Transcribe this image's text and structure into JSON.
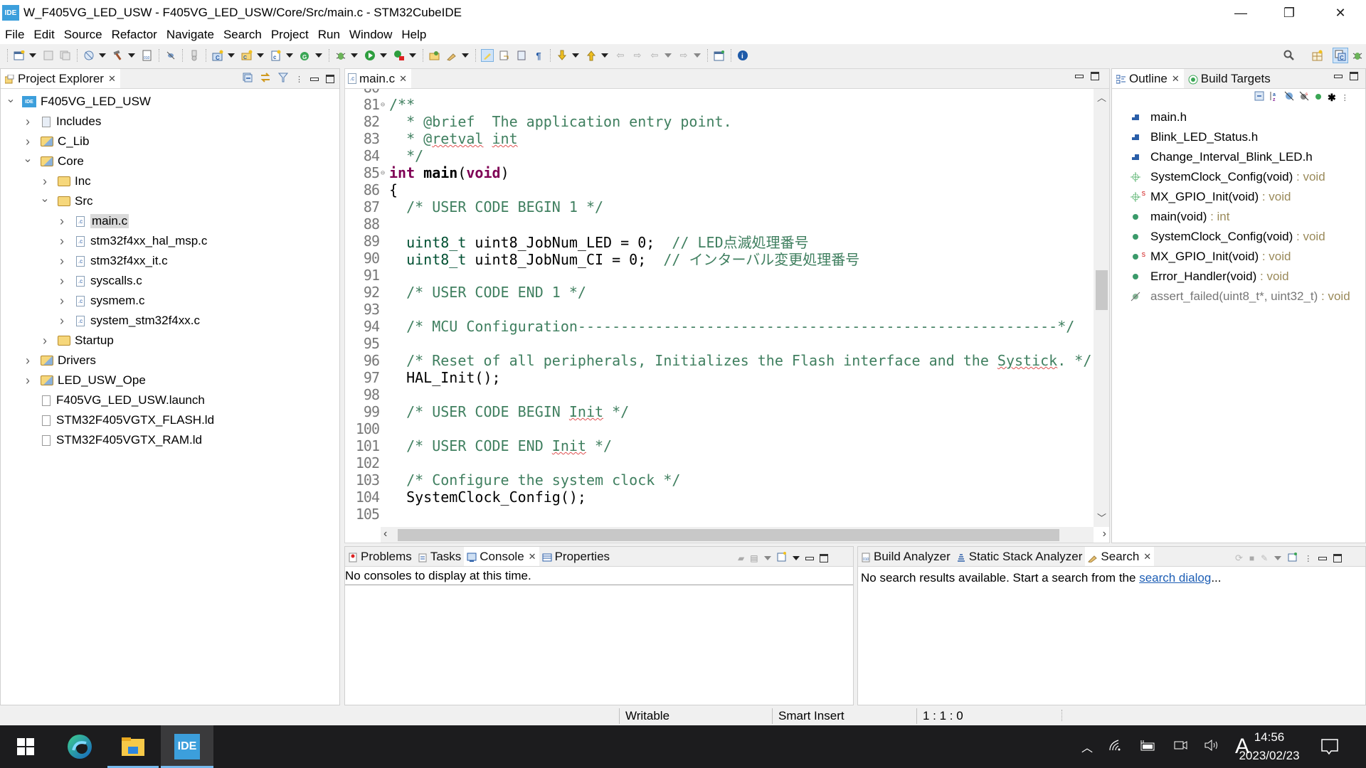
{
  "window": {
    "app_icon_label": "IDE",
    "title": "W_F405VG_LED_USW - F405VG_LED_USW/Core/Src/main.c - STM32CubeIDE",
    "minimize_glyph": "—",
    "restore_glyph": "❐",
    "close_glyph": "✕"
  },
  "menu": [
    "File",
    "Edit",
    "Source",
    "Refactor",
    "Navigate",
    "Search",
    "Project",
    "Run",
    "Window",
    "Help"
  ],
  "toolbar": {
    "icons": [
      "new-icon",
      "save-icon",
      "save-all-icon",
      "build-config-icon",
      "build-hammer-icon",
      "binary-icon",
      "debug-disconnect-icon",
      "device-config-icon",
      "new-c-project-icon",
      "new-source-folder-icon",
      "new-c-file-icon",
      "new-class-icon",
      "debug-icon",
      "run-icon",
      "run-external-icon",
      "open-perspective-icon",
      "mark-occurrences-icon",
      "toggle-highlight-icon",
      "show-whitespace-icon",
      "next-annotation-icon",
      "prev-annotation-icon",
      "back-icon",
      "forward-icon",
      "pin-editor-icon",
      "info-icon"
    ],
    "right_icons": [
      "search-icon",
      "open-perspective-icon",
      "c-perspective-icon",
      "debug-perspective-icon"
    ]
  },
  "project_explorer": {
    "tab_label": "Project Explorer",
    "items": [
      {
        "label": "F405VG_LED_USW",
        "depth": 0,
        "expanded": true,
        "icon": "project-icon"
      },
      {
        "label": "Includes",
        "depth": 1,
        "expanded": false,
        "icon": "includes-icon"
      },
      {
        "label": "C_Lib",
        "depth": 1,
        "expanded": false,
        "icon": "source-folder-icon"
      },
      {
        "label": "Core",
        "depth": 1,
        "expanded": true,
        "icon": "source-folder-icon"
      },
      {
        "label": "Inc",
        "depth": 2,
        "expanded": false,
        "icon": "folder-icon"
      },
      {
        "label": "Src",
        "depth": 2,
        "expanded": true,
        "icon": "folder-icon"
      },
      {
        "label": "main.c",
        "depth": 3,
        "expanded": false,
        "icon": "c-file-icon",
        "selected": true
      },
      {
        "label": "stm32f4xx_hal_msp.c",
        "depth": 3,
        "expanded": false,
        "icon": "c-file-icon"
      },
      {
        "label": "stm32f4xx_it.c",
        "depth": 3,
        "expanded": false,
        "icon": "c-file-icon"
      },
      {
        "label": "syscalls.c",
        "depth": 3,
        "expanded": false,
        "icon": "c-file-icon"
      },
      {
        "label": "sysmem.c",
        "depth": 3,
        "expanded": false,
        "icon": "c-file-icon"
      },
      {
        "label": "system_stm32f4xx.c",
        "depth": 3,
        "expanded": false,
        "icon": "c-file-icon"
      },
      {
        "label": "Startup",
        "depth": 2,
        "expanded": false,
        "icon": "folder-icon"
      },
      {
        "label": "Drivers",
        "depth": 1,
        "expanded": false,
        "icon": "source-folder-icon"
      },
      {
        "label": "LED_USW_Ope",
        "depth": 1,
        "expanded": false,
        "icon": "source-folder-icon"
      },
      {
        "label": "F405VG_LED_USW.launch",
        "depth": 1,
        "expanded": null,
        "icon": "file-icon"
      },
      {
        "label": "STM32F405VGTX_FLASH.ld",
        "depth": 1,
        "expanded": null,
        "icon": "ld-file-icon"
      },
      {
        "label": "STM32F405VGTX_RAM.ld",
        "depth": 1,
        "expanded": null,
        "icon": "ld-file-icon"
      }
    ]
  },
  "editor": {
    "tab_label": "main.c",
    "scroll_position": 0.45,
    "lines": [
      {
        "n": "81",
        "fold": "⊖",
        "segs": [
          [
            "c-comment",
            "/**"
          ]
        ]
      },
      {
        "n": "82",
        "fold": "",
        "segs": [
          [
            "c-comment",
            "  * @brief  The application entry point."
          ]
        ]
      },
      {
        "n": "83",
        "fold": "",
        "segs": [
          [
            "c-comment",
            "  * @"
          ],
          [
            "c-comment squig",
            "retval"
          ],
          [
            "c-comment",
            " "
          ],
          [
            "c-comment squig",
            "int"
          ]
        ]
      },
      {
        "n": "84",
        "fold": "",
        "segs": [
          [
            "c-comment",
            "  */"
          ]
        ]
      },
      {
        "n": "85",
        "fold": "⊖",
        "segs": [
          [
            "c-kw",
            "int"
          ],
          [
            "c-plain",
            " "
          ],
          [
            "c-bold",
            "main"
          ],
          [
            "c-plain",
            "("
          ],
          [
            "c-kw",
            "void"
          ],
          [
            "c-plain",
            ")"
          ]
        ]
      },
      {
        "n": "86",
        "fold": "",
        "segs": [
          [
            "c-plain",
            "{"
          ]
        ]
      },
      {
        "n": "87",
        "fold": "",
        "segs": [
          [
            "c-comment",
            "  /* USER CODE BEGIN 1 */"
          ]
        ]
      },
      {
        "n": "88",
        "fold": "",
        "segs": []
      },
      {
        "n": "89",
        "fold": "",
        "segs": [
          [
            "c-plain",
            "  "
          ],
          [
            "c-type",
            "uint8_t"
          ],
          [
            "c-plain",
            " uint8_JobNum_LED = 0;  "
          ],
          [
            "c-comment",
            "// LED点滅処理番号"
          ]
        ]
      },
      {
        "n": "90",
        "fold": "",
        "segs": [
          [
            "c-plain",
            "  "
          ],
          [
            "c-type",
            "uint8_t"
          ],
          [
            "c-plain",
            " uint8_JobNum_CI = 0;  "
          ],
          [
            "c-comment",
            "// インターバル変更処理番号"
          ]
        ]
      },
      {
        "n": "91",
        "fold": "",
        "segs": []
      },
      {
        "n": "92",
        "fold": "",
        "segs": [
          [
            "c-comment",
            "  /* USER CODE END 1 */"
          ]
        ]
      },
      {
        "n": "93",
        "fold": "",
        "segs": []
      },
      {
        "n": "94",
        "fold": "",
        "segs": [
          [
            "c-comment",
            "  /* MCU Configuration--------------------------------------------------------*/"
          ]
        ]
      },
      {
        "n": "95",
        "fold": "",
        "segs": []
      },
      {
        "n": "96",
        "fold": "",
        "segs": [
          [
            "c-comment",
            "  /* Reset of all peripherals, Initializes the Flash interface and the "
          ],
          [
            "c-comment squig",
            "Systick"
          ],
          [
            "c-comment",
            ". */"
          ]
        ]
      },
      {
        "n": "97",
        "fold": "",
        "segs": [
          [
            "c-plain",
            "  HAL_Init();"
          ]
        ]
      },
      {
        "n": "98",
        "fold": "",
        "segs": []
      },
      {
        "n": "99",
        "fold": "",
        "segs": [
          [
            "c-comment",
            "  /* USER CODE BEGIN "
          ],
          [
            "c-comment squig",
            "Init"
          ],
          [
            "c-comment",
            " */"
          ]
        ]
      },
      {
        "n": "100",
        "fold": "",
        "segs": []
      },
      {
        "n": "101",
        "fold": "",
        "segs": [
          [
            "c-comment",
            "  /* USER CODE END "
          ],
          [
            "c-comment squig",
            "Init"
          ],
          [
            "c-comment",
            " */"
          ]
        ]
      },
      {
        "n": "102",
        "fold": "",
        "segs": []
      },
      {
        "n": "103",
        "fold": "",
        "segs": [
          [
            "c-comment",
            "  /* Configure the system clock */"
          ]
        ]
      },
      {
        "n": "104",
        "fold": "",
        "segs": [
          [
            "c-plain",
            "  SystemClock_Config();"
          ]
        ]
      },
      {
        "n": "105",
        "fold": "",
        "segs": []
      }
    ]
  },
  "outline": {
    "tabs": [
      {
        "label": "Outline",
        "active": true
      },
      {
        "label": "Build Targets",
        "active": false
      }
    ],
    "items": [
      {
        "icon": "include-icon",
        "name": "main.h",
        "ret": ""
      },
      {
        "icon": "include-icon",
        "name": "Blink_LED_Status.h",
        "ret": ""
      },
      {
        "icon": "include-icon",
        "name": "Change_Interval_Blink_LED.h",
        "ret": ""
      },
      {
        "icon": "function-declaration-icon",
        "name": "SystemClock_Config(void)",
        "ret": " : void"
      },
      {
        "icon": "static-function-declaration-icon",
        "name": "MX_GPIO_Init(void)",
        "ret": " : void"
      },
      {
        "icon": "function-icon",
        "name": "main(void)",
        "ret": " : int"
      },
      {
        "icon": "function-icon",
        "name": "SystemClock_Config(void)",
        "ret": " : void"
      },
      {
        "icon": "static-function-icon",
        "name": "MX_GPIO_Init(void)",
        "ret": " : void"
      },
      {
        "icon": "function-icon",
        "name": "Error_Handler(void)",
        "ret": " : void"
      },
      {
        "icon": "inactive-function-icon",
        "name": "assert_failed(uint8_t*, uint32_t)",
        "ret": " : void",
        "dim": true
      }
    ]
  },
  "console_panel": {
    "tabs": [
      {
        "label": "Problems",
        "icon": "problems-icon",
        "active": false
      },
      {
        "label": "Tasks",
        "icon": "tasks-icon",
        "active": false
      },
      {
        "label": "Console",
        "icon": "console-icon",
        "active": true
      },
      {
        "label": "Properties",
        "icon": "properties-icon",
        "active": false
      }
    ],
    "message": "No consoles to display at this time."
  },
  "search_panel": {
    "tabs": [
      {
        "label": "Build Analyzer",
        "icon": "build-analyzer-icon",
        "active": false
      },
      {
        "label": "Static Stack Analyzer",
        "icon": "stack-analyzer-icon",
        "active": false
      },
      {
        "label": "Search",
        "icon": "search-flashlight-icon",
        "active": true
      }
    ],
    "message_prefix": "No search results available. Start a search from the ",
    "link_text": "search dialog",
    "message_suffix": "..."
  },
  "statusbar": {
    "writable": "Writable",
    "insert_mode": "Smart Insert",
    "position": "1 : 1 : 0"
  },
  "taskbar": {
    "apps": [
      "start-button",
      "edge-browser",
      "file-explorer",
      "stm32cubeide"
    ],
    "ide_label": "IDE",
    "ime": "A",
    "time": "14:56",
    "date": "2023/02/23"
  }
}
